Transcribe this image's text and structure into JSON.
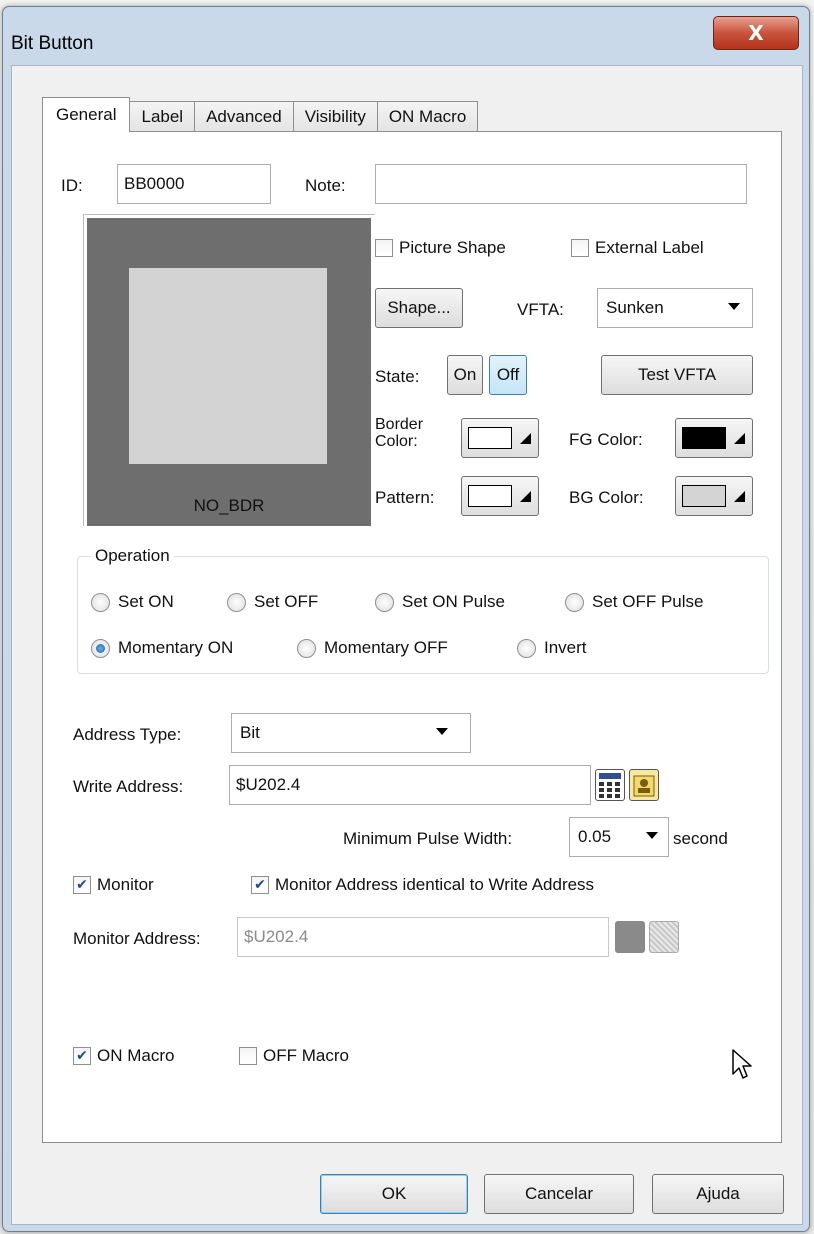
{
  "window": {
    "title": "Bit Button",
    "close_label": "X"
  },
  "tabs": [
    {
      "label": "General",
      "active": true
    },
    {
      "label": "Label",
      "active": false
    },
    {
      "label": "Advanced",
      "active": false
    },
    {
      "label": "Visibility",
      "active": false
    },
    {
      "label": "ON Macro",
      "active": false
    }
  ],
  "general": {
    "id_label": "ID:",
    "id_value": "BB0000",
    "note_label": "Note:",
    "note_value": "",
    "preview_label": "NO_BDR",
    "picture_shape_label": "Picture Shape",
    "picture_shape_checked": false,
    "external_label_label": "External Label",
    "external_label_checked": false,
    "shape_button": "Shape...",
    "vfta_label": "VFTA:",
    "vfta_value": "Sunken",
    "state_label": "State:",
    "state_on": "On",
    "state_off": "Off",
    "test_vfta_button": "Test VFTA",
    "border_color_label_1": "Border",
    "border_color_label_2": "Color:",
    "fg_color_label": "FG Color:",
    "pattern_label": "Pattern:",
    "bg_color_label": "BG Color:",
    "colors": {
      "border": "#ffffff",
      "fg": "#000000",
      "pattern": "#ffffff",
      "bg": "#d4d4d4"
    }
  },
  "operation": {
    "title": "Operation",
    "options": [
      {
        "label": "Set ON",
        "selected": false
      },
      {
        "label": "Set OFF",
        "selected": false
      },
      {
        "label": "Set ON Pulse",
        "selected": false
      },
      {
        "label": "Set OFF Pulse",
        "selected": false
      },
      {
        "label": "Momentary ON",
        "selected": true
      },
      {
        "label": "Momentary OFF",
        "selected": false
      },
      {
        "label": "Invert",
        "selected": false
      }
    ]
  },
  "address": {
    "type_label": "Address Type:",
    "type_value": "Bit",
    "write_label": "Write Address:",
    "write_value": "$U202.4",
    "min_pulse_label": "Minimum Pulse Width:",
    "min_pulse_value": "0.05",
    "min_pulse_unit": "second",
    "monitor_label": "Monitor",
    "monitor_checked": true,
    "monitor_identical_label": "Monitor Address identical to Write Address",
    "monitor_identical_checked": true,
    "monitor_address_label": "Monitor Address:",
    "monitor_address_value": "$U202.4"
  },
  "macros": {
    "on_macro_label": "ON Macro",
    "on_macro_checked": true,
    "off_macro_label": "OFF Macro",
    "off_macro_checked": false
  },
  "footer": {
    "ok": "OK",
    "cancel": "Cancelar",
    "help": "Ajuda"
  }
}
